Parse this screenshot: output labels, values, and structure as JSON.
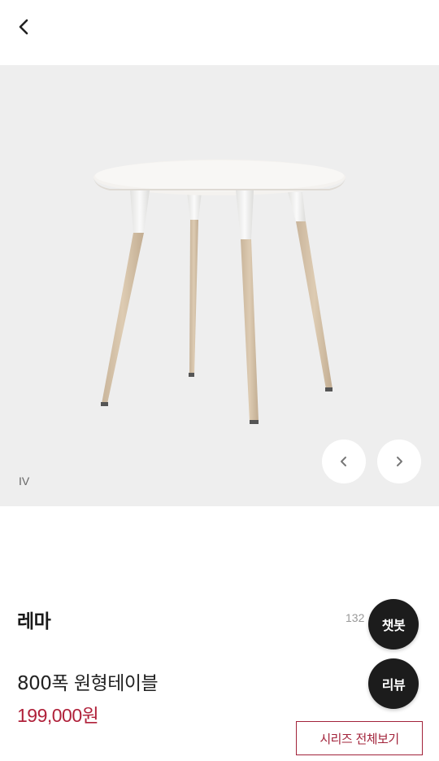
{
  "header": {
    "back_icon": "chevron-left-icon"
  },
  "gallery": {
    "image_alt": "round table",
    "image_label": "IV",
    "prev_icon": "chevron-left-icon",
    "next_icon": "chevron-right-icon"
  },
  "product": {
    "series_name": "레마",
    "like_count": "132",
    "name": "800폭 원형테이블",
    "price": "199,000원"
  },
  "floating": {
    "chatbot_label": "챗봇",
    "review_label": "리뷰"
  },
  "actions": {
    "series_all_label": "시리즈 전체보기"
  },
  "colors": {
    "accent": "#a2233a",
    "fab_bg": "#1c1c1c",
    "hero_bg": "#eeeeee"
  }
}
